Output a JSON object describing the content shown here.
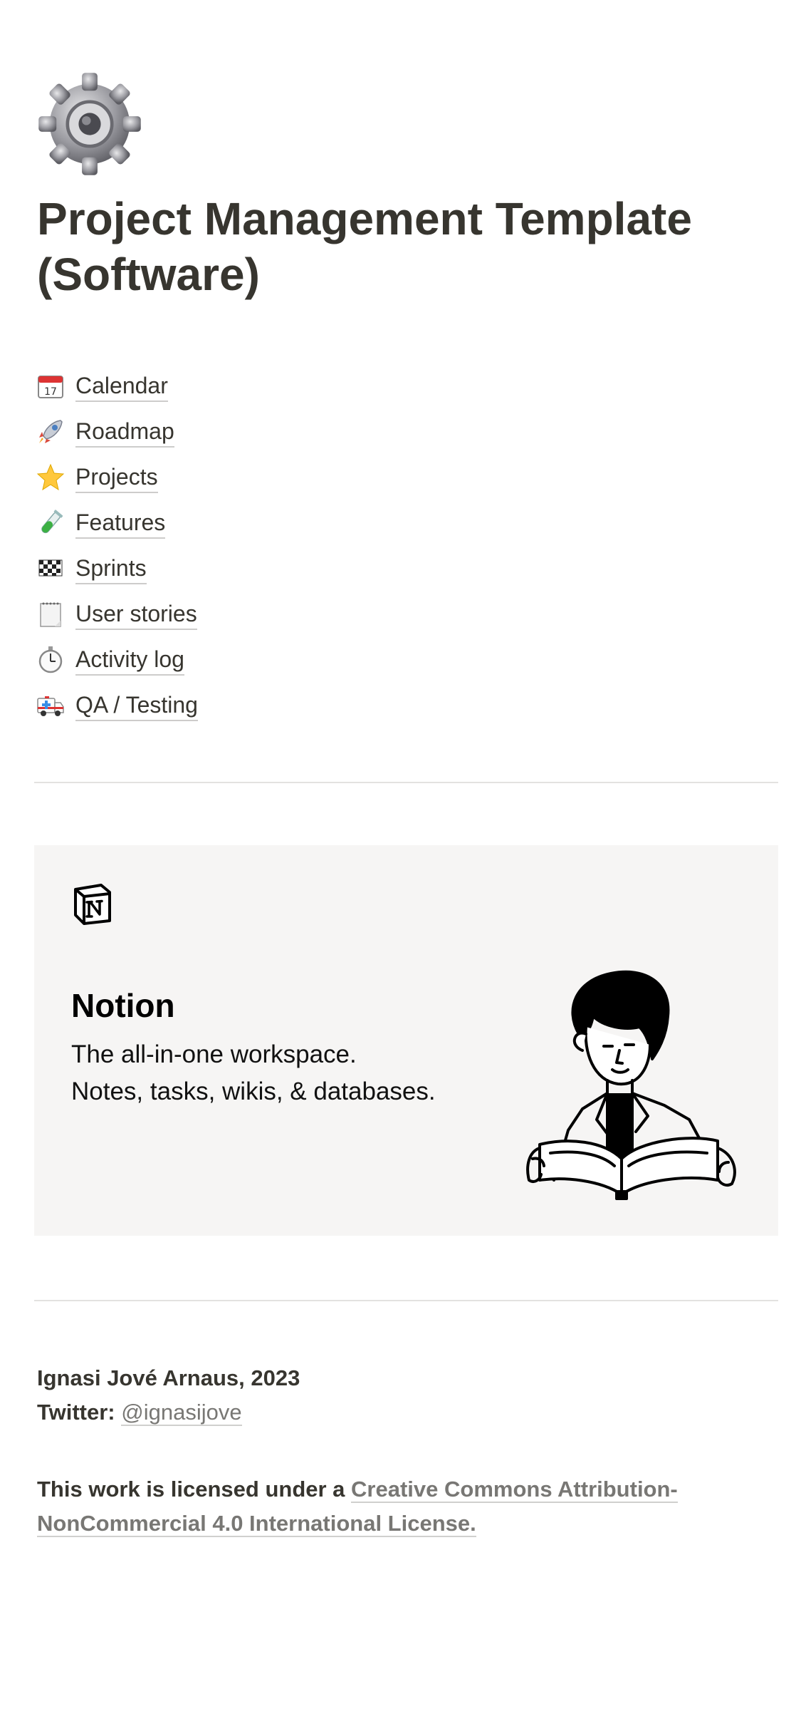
{
  "page": {
    "icon": "gear-icon",
    "title": "Project Management Template (Software)"
  },
  "links": [
    {
      "icon": "calendar-icon",
      "label": "Calendar"
    },
    {
      "icon": "rocket-icon",
      "label": "Roadmap"
    },
    {
      "icon": "star-icon",
      "label": "Projects"
    },
    {
      "icon": "test-tube-icon",
      "label": "Features"
    },
    {
      "icon": "checkered-flag-icon",
      "label": "Sprints"
    },
    {
      "icon": "notepad-icon",
      "label": "User stories"
    },
    {
      "icon": "stopwatch-icon",
      "label": "Activity log"
    },
    {
      "icon": "ambulance-icon",
      "label": "QA / Testing"
    }
  ],
  "bookmark": {
    "logo": "notion-logo",
    "title": "Notion",
    "line1": "The all-in-one workspace.",
    "line2": "Notes, tasks, wikis, & databases.",
    "illustration": "person-reading-book"
  },
  "footer": {
    "author": "Ignasi Jové Arnaus, 2023",
    "twitter_label": "Twitter:",
    "twitter_handle": "@ignasijove",
    "license_prefix": "This work is licensed under a",
    "license_link": "Creative Commons Attribution-NonCommercial 4.0 International License."
  },
  "colors": {
    "text": "#37352f",
    "muted": "#787774",
    "bookmark_bg": "#f6f5f4",
    "divider": "#e3e2e0"
  }
}
